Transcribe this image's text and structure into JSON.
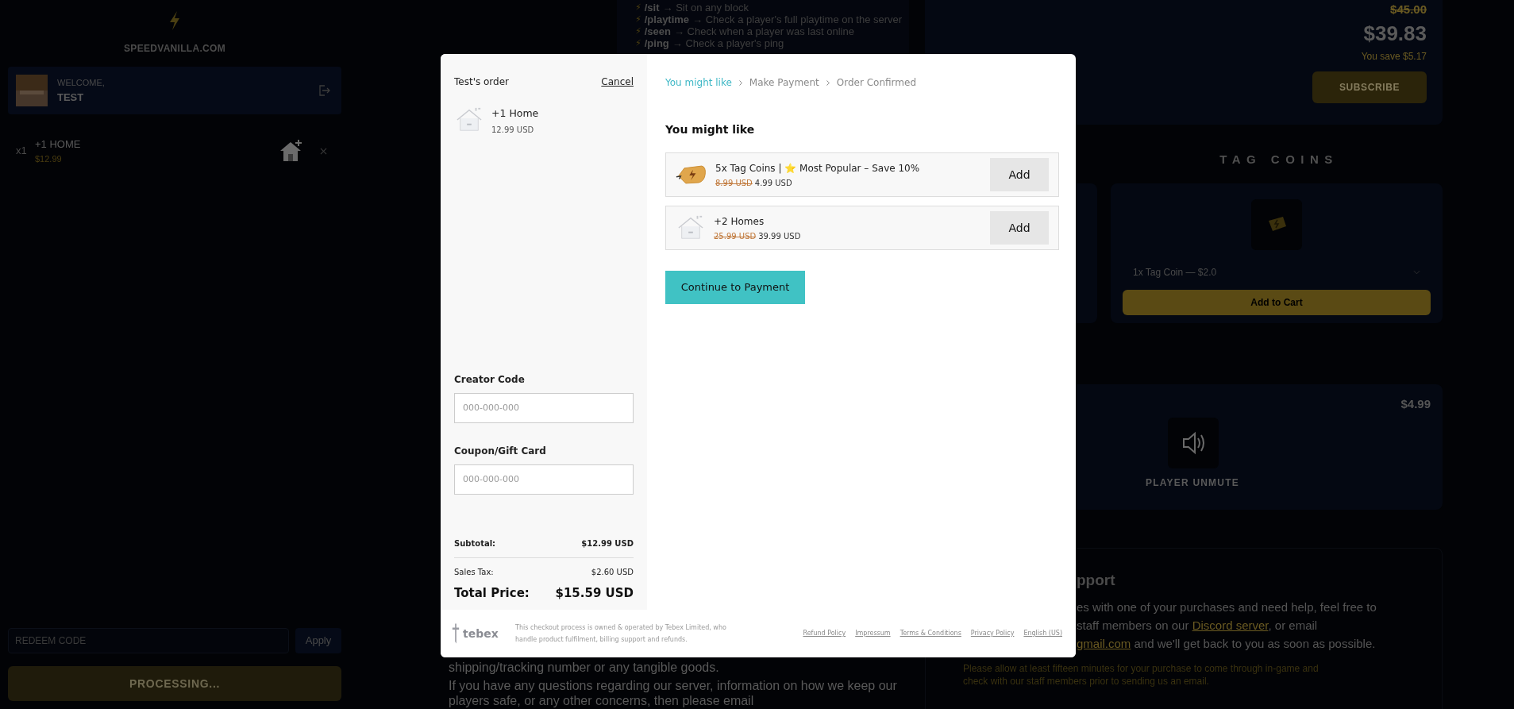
{
  "sidebar": {
    "logo": "SPEEDVANILLA.COM",
    "welcome": {
      "greeting": "WELCOME,",
      "user": "TEST"
    },
    "cart_items": [
      {
        "quantity": "x1",
        "name": "+1 HOME",
        "price": "$12.99"
      }
    ],
    "redeem": {
      "placeholder": "REDEEM CODE",
      "button": "Apply"
    },
    "checkout_button": "PROCESSING..."
  },
  "commands": [
    {
      "icon": "⚡",
      "command": "/sit",
      "description": "→ Sit on any block"
    },
    {
      "icon": "⚡",
      "command": "/playtime",
      "description": "→ Check a player's full playtime on the server"
    },
    {
      "icon": "⚡",
      "command": "/seen",
      "description": "→ Check when a player was last online"
    },
    {
      "icon": "⚡",
      "command": "/ping",
      "description": "→ Check a player's ping"
    }
  ],
  "about_text": [
    "shipping/tracking number or any tangible goods.",
    "If you have any questions regarding our server, information on how we keep our players safe, or any other concerns, then please email"
  ],
  "subscription": {
    "old_price": "$45.00",
    "price": "$39.83",
    "savings": "You save $5.17",
    "button": "SUBSCRIBE"
  },
  "tag_coins": {
    "heading": "TAG COINS",
    "option": "1x Tag Coin — $2.0",
    "button": "Add to Cart"
  },
  "unmute": {
    "price": "$4.99",
    "name": "PLAYER UNMUTE"
  },
  "support": {
    "heading": "pport",
    "lines": [
      [
        {
          "text": "es with one of your purchases and need help, feel free to",
          "link": false
        }
      ],
      [
        {
          "text": "staff members on our ",
          "link": false
        },
        {
          "text": "Discord server",
          "link": true
        },
        {
          "text": ", or email",
          "link": false
        }
      ],
      [
        {
          "text": "gmail.com",
          "link": true
        },
        {
          "text": " and we'll get back to you as soon as possible.",
          "link": false
        }
      ]
    ],
    "note": "Please allow at least fifteen minutes for your purchase to come through in-game and check with our staff members prior to sending us an email."
  },
  "checkout": {
    "order_title": "Test's order",
    "cancel": "Cancel",
    "items": [
      {
        "name": "+1 Home",
        "price": "12.99 USD"
      }
    ],
    "creator_code": {
      "label": "Creator Code",
      "placeholder": "000-000-000"
    },
    "coupon": {
      "label": "Coupon/Gift Card",
      "placeholder": "000-000-000"
    },
    "subtotal": {
      "label": "Subtotal:",
      "value": "$12.99 USD"
    },
    "tax": {
      "label": "Sales Tax:",
      "value": "$2.60 USD"
    },
    "total": {
      "label": "Total Price:",
      "value": "$15.59 USD"
    },
    "steps": [
      {
        "label": "You might like",
        "selected": true
      },
      {
        "label": "Make Payment",
        "selected": false
      },
      {
        "label": "Order Confirmed",
        "selected": false
      }
    ],
    "heading": "You might like",
    "upsells": [
      {
        "kind": "coins",
        "name": "5x Tag Coins | ⭐ Most Popular – Save 10%",
        "old_price": "8.99 USD",
        "price": "4.99 USD",
        "button": "Add"
      },
      {
        "kind": "house",
        "name": "+2 Homes",
        "old_price": "25.99 USD",
        "price": "39.99 USD",
        "button": "Add"
      }
    ],
    "continue_button": "Continue to Payment",
    "footer": {
      "brand": "tebex",
      "notice": "This checkout process is owned & operated by Tebex Limited, who handle product fulfilment, billing support and refunds.",
      "links": [
        "Refund Policy",
        "Impressum",
        "Terms & Conditions",
        "Privacy Policy",
        "English (US)"
      ]
    }
  }
}
